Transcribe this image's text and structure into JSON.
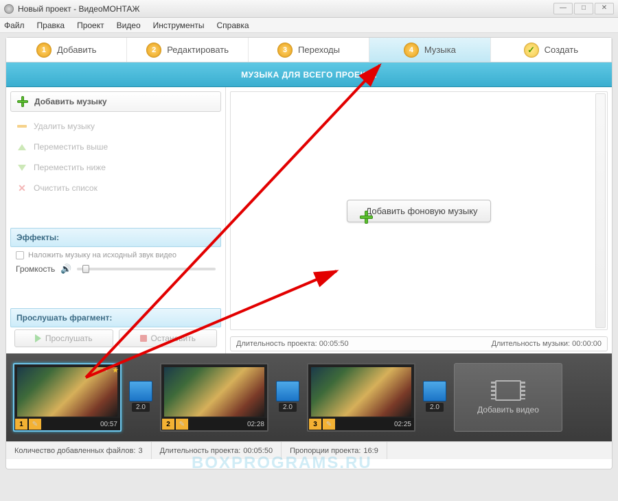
{
  "window": {
    "title": "Новый проект - ВидеоМОНТАЖ"
  },
  "menu": [
    "Файл",
    "Правка",
    "Проект",
    "Видео",
    "Инструменты",
    "Справка"
  ],
  "steps": [
    {
      "num": "1",
      "label": "Добавить"
    },
    {
      "num": "2",
      "label": "Редактировать"
    },
    {
      "num": "3",
      "label": "Переходы"
    },
    {
      "num": "4",
      "label": "Музыка"
    },
    {
      "num": "",
      "label": "Создать"
    }
  ],
  "header": {
    "title": "МУЗЫКА ДЛЯ ВСЕГО ПРОЕКТА"
  },
  "sidebar": {
    "add": "Добавить музыку",
    "remove": "Удалить музыку",
    "moveup": "Переместить выше",
    "movedown": "Переместить ниже",
    "clear": "Очистить список",
    "effects_label": "Эффекты:",
    "overlay_label": "Наложить музыку на исходный звук видео",
    "volume_label": "Громкость",
    "preview_label": "Прослушать фрагмент:",
    "listen": "Прослушать",
    "stop": "Остановить"
  },
  "rightpane": {
    "add_bg_music": "Добавить фоновую музыку",
    "project_duration_label": "Длительность проекта:",
    "project_duration_value": "00:05:50",
    "music_duration_label": "Длительность музыки:",
    "music_duration_value": "00:00:00"
  },
  "timeline": {
    "clips": [
      {
        "num": "1",
        "duration": "00:57"
      },
      {
        "num": "2",
        "duration": "02:28"
      },
      {
        "num": "3",
        "duration": "02:25"
      }
    ],
    "transition_label": "2.0",
    "add_video": "Добавить видео"
  },
  "status": {
    "files_label": "Количество добавленных файлов:",
    "files_value": "3",
    "duration_label": "Длительность проекта:",
    "duration_value": "00:05:50",
    "aspect_label": "Пропорции проекта:",
    "aspect_value": "16:9"
  },
  "watermark": "BOXPROGRAMS.RU"
}
